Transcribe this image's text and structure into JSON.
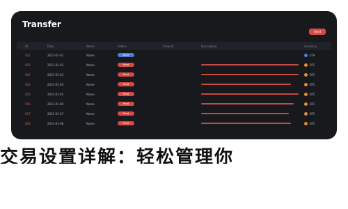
{
  "window": {
    "title": "Transfer",
    "action_button": "Send"
  },
  "table": {
    "headers": [
      "ID",
      "Date",
      "Name",
      "Status",
      "Amount",
      "Description",
      "Currency"
    ],
    "rows": [
      {
        "id": "001",
        "date": "2023-01-01",
        "name": "Name",
        "status": "Done",
        "status_color": "#4c7fd6",
        "bar_width_frac": 0.0,
        "desc": "",
        "currency": "ETH",
        "dot": "blue"
      },
      {
        "id": "002",
        "date": "2023-01-02",
        "name": "Name",
        "status": "Pend",
        "status_color": "#d94a45",
        "bar_width_frac": 1.0,
        "desc": "",
        "currency": "BTC",
        "dot": "orange"
      },
      {
        "id": "003",
        "date": "2023-01-03",
        "name": "Name",
        "status": "Pend",
        "status_color": "#d94a45",
        "bar_width_frac": 1.0,
        "desc": "",
        "currency": "BTC",
        "dot": "orange"
      },
      {
        "id": "004",
        "date": "2023-01-04",
        "name": "Name",
        "status": "Pend",
        "status_color": "#d94a45",
        "bar_width_frac": 0.92,
        "desc": "",
        "currency": "BTC",
        "dot": "orange"
      },
      {
        "id": "005",
        "date": "2023-01-05",
        "name": "Name",
        "status": "Pend",
        "status_color": "#d94a45",
        "bar_width_frac": 1.0,
        "desc": "",
        "currency": "BTC",
        "dot": "orange"
      },
      {
        "id": "006",
        "date": "2023-01-06",
        "name": "Name",
        "status": "Pend",
        "status_color": "#d94a45",
        "bar_width_frac": 0.95,
        "desc": "",
        "currency": "BTC",
        "dot": "orange"
      },
      {
        "id": "007",
        "date": "2023-01-07",
        "name": "Name",
        "status": "Pend",
        "status_color": "#d94a45",
        "bar_width_frac": 0.9,
        "desc": "",
        "currency": "BTC",
        "dot": "orange"
      },
      {
        "id": "008",
        "date": "2023-01-08",
        "name": "Name",
        "status": "Pend",
        "status_color": "#d94a45",
        "bar_width_frac": 0.92,
        "desc": "",
        "currency": "BTC",
        "dot": "orange"
      }
    ]
  },
  "caption": "交易设置详解：轻松管理你"
}
